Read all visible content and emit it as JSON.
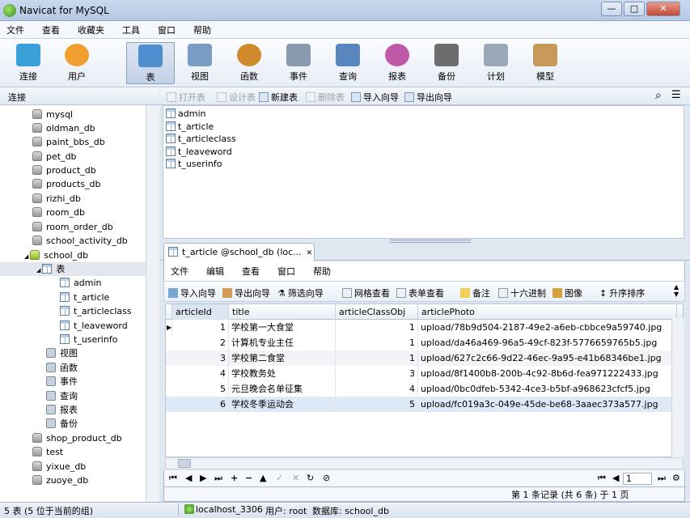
{
  "window": {
    "title": "Navicat for MySQL",
    "minimize": "—",
    "maximize": "□",
    "close": "✕"
  },
  "menu": [
    "文件",
    "查看",
    "收藏夹",
    "工具",
    "窗口",
    "帮助"
  ],
  "toolbar": [
    {
      "label": "连接",
      "icon": "connection-icon",
      "color": "#3aa0d8"
    },
    {
      "label": "用户",
      "icon": "user-icon",
      "color": "#f0a030"
    },
    {
      "label": "表",
      "icon": "table-icon",
      "color": "#4f8fd0"
    },
    {
      "label": "视图",
      "icon": "view-icon",
      "color": "#7b9cc2"
    },
    {
      "label": "函数",
      "icon": "function-icon",
      "color": "#d08a2c"
    },
    {
      "label": "事件",
      "icon": "event-icon",
      "color": "#8a9aae"
    },
    {
      "label": "查询",
      "icon": "query-icon",
      "color": "#5a86c0"
    },
    {
      "label": "报表",
      "icon": "report-icon",
      "color": "#c05aa8"
    },
    {
      "label": "备份",
      "icon": "backup-icon",
      "color": "#6d6d6d"
    },
    {
      "label": "计划",
      "icon": "schedule-icon",
      "color": "#9aa8b8"
    },
    {
      "label": "模型",
      "icon": "model-icon",
      "color": "#c89a5a"
    }
  ],
  "left_header": "连接",
  "tree": [
    {
      "label": "mysql",
      "icon": "database-icon"
    },
    {
      "label": "oldman_db",
      "icon": "database-icon"
    },
    {
      "label": "paint_bbs_db",
      "icon": "database-icon"
    },
    {
      "label": "pet_db",
      "icon": "database-icon"
    },
    {
      "label": "product_db",
      "icon": "database-icon"
    },
    {
      "label": "products_db",
      "icon": "database-icon"
    },
    {
      "label": "rizhi_db",
      "icon": "database-icon"
    },
    {
      "label": "room_db",
      "icon": "database-icon"
    },
    {
      "label": "room_order_db",
      "icon": "database-icon"
    },
    {
      "label": "school_activity_db",
      "icon": "database-icon"
    },
    {
      "label": "school_db",
      "icon": "database-open-icon",
      "expanded": "◢"
    },
    {
      "label": "表",
      "icon": "tables-folder-icon",
      "expanded": "◢"
    },
    {
      "label": "admin",
      "icon": "table-icon"
    },
    {
      "label": "t_article",
      "icon": "table-icon"
    },
    {
      "label": "t_articleclass",
      "icon": "table-icon"
    },
    {
      "label": "t_leaveword",
      "icon": "table-icon"
    },
    {
      "label": "t_userinfo",
      "icon": "table-icon"
    },
    {
      "label": "视图",
      "icon": "views-icon"
    },
    {
      "label": "函数",
      "icon": "functions-icon"
    },
    {
      "label": "事件",
      "icon": "events-icon"
    },
    {
      "label": "查询",
      "icon": "queries-icon"
    },
    {
      "label": "报表",
      "icon": "reports-icon"
    },
    {
      "label": "备份",
      "icon": "backups-icon"
    },
    {
      "label": "shop_product_db",
      "icon": "database-icon"
    },
    {
      "label": "test",
      "icon": "database-icon"
    },
    {
      "label": "yixue_db",
      "icon": "database-icon"
    },
    {
      "label": "zuoye_db",
      "icon": "database-icon"
    }
  ],
  "obj_toolbar": [
    {
      "label": "打开表",
      "disabled": true
    },
    {
      "label": "设计表",
      "disabled": true
    },
    {
      "label": "新建表",
      "disabled": false
    },
    {
      "label": "删除表",
      "disabled": true
    },
    {
      "label": "导入向导",
      "disabled": false
    },
    {
      "label": "导出向导",
      "disabled": false
    }
  ],
  "objects": [
    "admin",
    "t_article",
    "t_articleclass",
    "t_leaveword",
    "t_userinfo"
  ],
  "tab": {
    "label": "t_article @school_db (loc...",
    "close": "✕"
  },
  "inner_menu": [
    "文件",
    "编辑",
    "查看",
    "窗口",
    "帮助"
  ],
  "inner_toolbar": [
    "导入向导",
    "导出向导",
    "筛选向导",
    "网格查看",
    "表单查看",
    "备注",
    "十六进制",
    "图像",
    "升序排序"
  ],
  "grid": {
    "columns": [
      "articleId",
      "title",
      "articleClassObj",
      "articlePhoto"
    ],
    "rows": [
      {
        "articleId": "1",
        "title": "学校第一大食堂",
        "articleClassObj": "1",
        "articlePhoto": "upload/78b9d504-2187-49e2-a6eb-cbbce9a59740.jpg"
      },
      {
        "articleId": "2",
        "title": "计算机专业主任",
        "articleClassObj": "1",
        "articlePhoto": "upload/da46a469-96a5-49cf-823f-5776659765b5.jpg"
      },
      {
        "articleId": "3",
        "title": "学校第二食堂",
        "articleClassObj": "1",
        "articlePhoto": "upload/627c2c66-9d22-46ec-9a95-e41b68346be1.jpg"
      },
      {
        "articleId": "4",
        "title": "学校教务处",
        "articleClassObj": "3",
        "articlePhoto": "upload/8f1400b8-200b-4c92-8b6d-fea971222433.jpg"
      },
      {
        "articleId": "5",
        "title": "元旦晚会名单征集",
        "articleClassObj": "4",
        "articlePhoto": "upload/0bc0dfeb-5342-4ce3-b5bf-a968623cfcf5.jpg"
      },
      {
        "articleId": "6",
        "title": "学校冬季运动会",
        "articleClassObj": "5",
        "articlePhoto": "upload/fc019a3c-049e-45de-be68-3aaec373a577.jpg"
      }
    ]
  },
  "navbar": {
    "buttons": [
      "⏮",
      "◀",
      "▶",
      "⏭",
      "+",
      "−",
      "▲",
      "✓",
      "✕",
      "↻",
      "⊘"
    ],
    "right": [
      "⏮",
      "◀",
      "▶",
      "⏭",
      "⚙"
    ],
    "page": "1"
  },
  "record_info": "第 1 条记录 (共 6 条) 于 1 页",
  "status": {
    "count": "5 表 (5 位于当前的组)",
    "connection": "localhost_3306",
    "user": "用户: root",
    "database": "数据库: school_db"
  }
}
